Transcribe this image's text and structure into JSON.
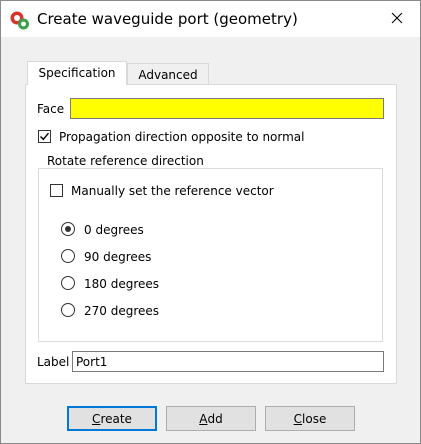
{
  "window": {
    "title": "Create waveguide port (geometry)",
    "icon": "app-logo-icon"
  },
  "tabs": [
    {
      "label": "Specification",
      "active": true
    },
    {
      "label": "Advanced",
      "active": false
    }
  ],
  "face": {
    "label": "Face",
    "value": "",
    "highlight_color": "#ffff00"
  },
  "propagation": {
    "label": "Propagation direction opposite to normal",
    "checked": true
  },
  "rotate_group": {
    "title": "Rotate reference direction",
    "manual_vector": {
      "label": "Manually set the reference vector",
      "checked": false
    },
    "options": [
      {
        "label": "0 degrees",
        "selected": true
      },
      {
        "label": "90 degrees",
        "selected": false
      },
      {
        "label": "180 degrees",
        "selected": false
      },
      {
        "label": "270 degrees",
        "selected": false
      }
    ]
  },
  "label_field": {
    "label": "Label",
    "value": "Port1"
  },
  "buttons": {
    "create": {
      "mnemonic": "C",
      "rest": "reate"
    },
    "add": {
      "mnemonic": "A",
      "rest": "dd"
    },
    "close": {
      "mnemonic": "C",
      "rest": "lose"
    }
  },
  "colors": {
    "accent": "#0078d7",
    "face_highlight": "#ffff00"
  }
}
